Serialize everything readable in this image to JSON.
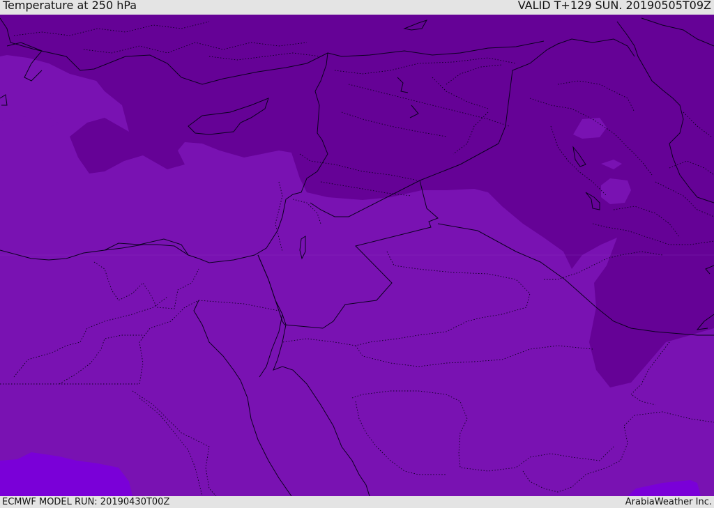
{
  "header": {
    "title": "Temperature at 250 hPa",
    "valid_time": "VALID T+129 SUN. 20190505T09Z"
  },
  "footer": {
    "model_run": "ECMWF MODEL RUN: 20190430T00Z",
    "credit": "ArabiaWeather Inc."
  },
  "map": {
    "field_colors": {
      "coldest_band": "#650296",
      "mid_band": "#7912b2",
      "warm_band": "#7a00d8"
    },
    "border_color": "#0b0020"
  }
}
